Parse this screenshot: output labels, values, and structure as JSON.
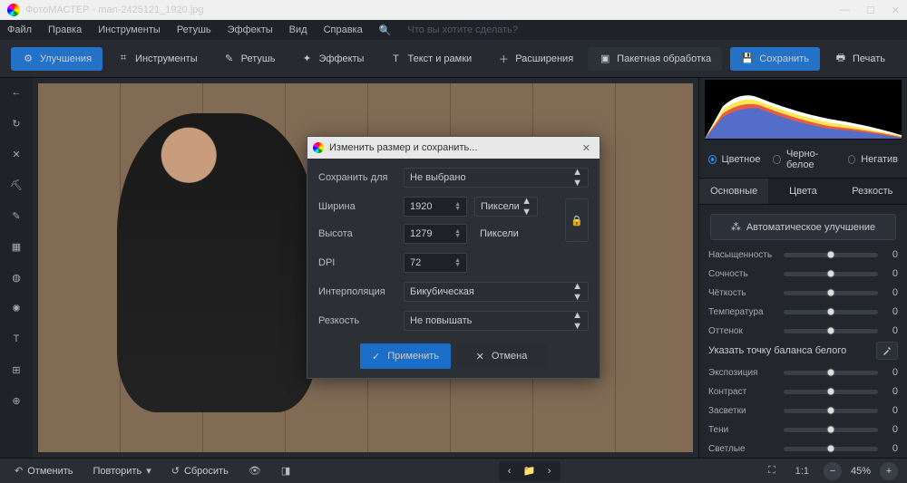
{
  "titlebar": {
    "app": "ФотоМАСТЕР",
    "file": "man-2425121_1920.jpg",
    "separator": " - "
  },
  "menubar": {
    "items": [
      "Файл",
      "Правка",
      "Инструменты",
      "Ретушь",
      "Эффекты",
      "Вид",
      "Справка"
    ],
    "search_placeholder": "Что вы хотите сделать?"
  },
  "toolbar": {
    "items": [
      {
        "label": "Улучшения",
        "icon": "sliders-icon",
        "active": true
      },
      {
        "label": "Инструменты",
        "icon": "crop-icon"
      },
      {
        "label": "Ретушь",
        "icon": "brush-icon"
      },
      {
        "label": "Эффекты",
        "icon": "sparkle-icon"
      },
      {
        "label": "Текст и рамки",
        "icon": "text-icon"
      },
      {
        "label": "Расширения",
        "icon": "plus-icon"
      },
      {
        "label": "Пакетная обработка",
        "icon": "batch-icon"
      }
    ],
    "save": "Сохранить",
    "print": "Печать"
  },
  "bottombar": {
    "undo": "Отменить",
    "redo": "Повторить",
    "reset": "Сбросить",
    "zoom": "45%",
    "ratio": "1:1"
  },
  "right": {
    "color_modes": {
      "color": "Цветное",
      "bw": "Черно-белое",
      "neg": "Негатив"
    },
    "tabs": {
      "basic": "Основные",
      "colors": "Цвета",
      "sharp": "Резкость"
    },
    "auto": "Автоматическое улучшение",
    "sliders": [
      {
        "label": "Насыщенность",
        "val": "0",
        "grad": "rainbow"
      },
      {
        "label": "Сочность",
        "val": "0",
        "grad": "rainbow"
      },
      {
        "label": "Чёткость",
        "val": "0",
        "grad": "plain"
      },
      {
        "label": "Температура",
        "val": "0",
        "grad": "tempgrad"
      },
      {
        "label": "Оттенок",
        "val": "0",
        "grad": "tintgrad"
      }
    ],
    "wb": "Указать точку баланса белого",
    "sliders2": [
      {
        "label": "Экспозиция",
        "val": "0"
      },
      {
        "label": "Контраст",
        "val": "0"
      },
      {
        "label": "Засветки",
        "val": "0"
      },
      {
        "label": "Тени",
        "val": "0"
      },
      {
        "label": "Светлые",
        "val": "0"
      }
    ]
  },
  "dialog": {
    "title": "Изменить размер и сохранить...",
    "save_for": {
      "label": "Сохранить для",
      "value": "Не выбрано"
    },
    "width": {
      "label": "Ширина",
      "value": "1920",
      "unit": "Пиксели"
    },
    "height": {
      "label": "Высота",
      "value": "1279",
      "unit": "Пиксели"
    },
    "dpi": {
      "label": "DPI",
      "value": "72"
    },
    "interp": {
      "label": "Интерполяция",
      "value": "Бикубическая"
    },
    "sharp": {
      "label": "Резкость",
      "value": "Не повышать"
    },
    "apply": "Применить",
    "cancel": "Отмена"
  }
}
